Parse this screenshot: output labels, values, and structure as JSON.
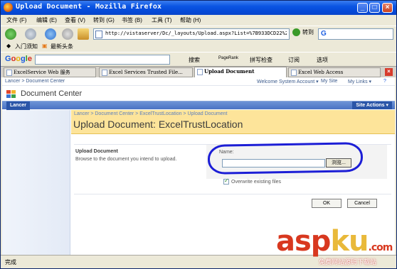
{
  "window": {
    "title": "Upload Document - Mozilla Firefox"
  },
  "menu": [
    "文件 (F)",
    "编辑 (E)",
    "查看 (V)",
    "转到 (G)",
    "书签 (B)",
    "工具 (T)",
    "帮助 (H)"
  ],
  "nav": {
    "url": "http://vistaserver/Dc/_layouts/Upload.aspx?List=%7B933DCD22%2D0A45%2",
    "go_label": "转到",
    "search_placeholder": "G"
  },
  "bookmarks": [
    "入门须知",
    "最新头条"
  ],
  "google_bar": {
    "logo": "Google",
    "search_label": "搜索",
    "pagerank_label": "PageRank",
    "spellcheck_label": "拼写检查",
    "rss_label": "订阅",
    "options_label": "选项"
  },
  "tabs": [
    {
      "label": "ExcelService Web 服务",
      "active": false
    },
    {
      "label": "Excel Services Trusted File...",
      "active": false
    },
    {
      "label": "Upload Document",
      "active": true
    },
    {
      "label": "Excel Web Access",
      "active": false
    }
  ],
  "sharepoint": {
    "top_breadcrumb": "Lancer > Document Center",
    "welcome": "Welcome System Account ▾",
    "my_site": "My Site",
    "my_links": "My Links ▾",
    "site_title": "Document Center",
    "nav_tab": "Lancer",
    "site_actions": "Site Actions ▾",
    "breadcrumb": "Lancer > Document Center > ExcelTrustLocation > Upload Document",
    "heading": "Upload Document: ExcelTrustLocation",
    "section_title": "Upload Document",
    "section_desc": "Browse to the document you intend to upload.",
    "name_label": "Name:",
    "browse_label": "浏览...",
    "overwrite_label": "Overwrite existing files",
    "overwrite_checked": true,
    "ok_label": "OK",
    "cancel_label": "Cancel"
  },
  "status": "完成",
  "watermark": {
    "text_a": "asp",
    "text_b": "ku",
    "text_c": ".com",
    "sub": "免费网站源码下载站"
  }
}
